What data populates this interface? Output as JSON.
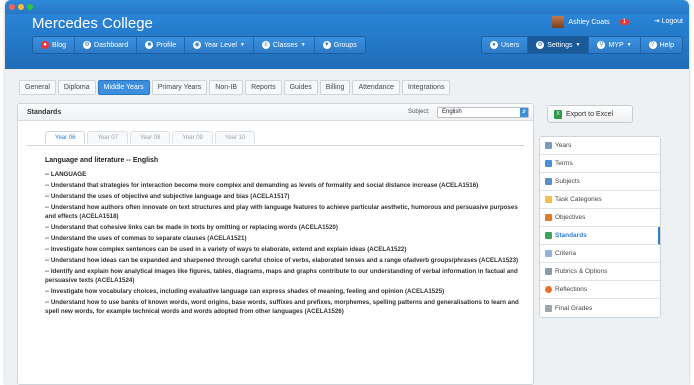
{
  "window": {
    "traffic_lights": [
      "#ff5f57",
      "#febc2e",
      "#28c840"
    ]
  },
  "brand": {
    "title": "Mercedes College"
  },
  "user": {
    "name": "Ashley Coats",
    "notification_count": "1",
    "logout": "Logout"
  },
  "nav_left": [
    {
      "label": "Blog",
      "icon": "blog-icon",
      "badge": ""
    },
    {
      "label": "Dashboard",
      "icon": "dashboard-icon"
    },
    {
      "label": "Profile",
      "icon": "profile-icon"
    },
    {
      "label": "Year Level",
      "icon": "globe-icon",
      "dropdown": true
    },
    {
      "label": "Classes",
      "icon": "list-icon",
      "dropdown": true
    },
    {
      "label": "Groups",
      "icon": "groups-icon"
    }
  ],
  "nav_right": [
    {
      "label": "Users",
      "icon": "users-icon"
    },
    {
      "label": "Settings",
      "icon": "gear-icon",
      "dropdown": true
    },
    {
      "label": "MYP",
      "icon": "search-icon",
      "dropdown": true
    },
    {
      "label": "Help",
      "icon": "help-icon"
    }
  ],
  "tabs": [
    "General",
    "Diploma",
    "Middle Years",
    "Primary Years",
    "Non-IB",
    "Reports",
    "Guides",
    "Billing",
    "Attendance",
    "Integrations"
  ],
  "active_tab": "Middle Years",
  "panel": {
    "title": "Standards",
    "subject_label": "Subject:",
    "subject_value": "English"
  },
  "year_tabs": [
    "Year 06",
    "Year 07",
    "Year 08",
    "Year 09",
    "Year 10"
  ],
  "active_year": "Year 06",
  "content": {
    "heading": "Language and literature -- English",
    "section": "-- LANGUAGE",
    "items": [
      "-- Understand that strategies for interaction become more complex and demanding as levels of formality and social distance increase (ACELA1516)",
      "-- Understand the uses of objective and subjective language and bias (ACELA1517)",
      "-- Understand how authors often innovate on text structures and play with language features to achieve particular aesthetic, humorous and persuasive purposes and effects (ACELA1518)",
      "-- Understand that cohesive links can be made in texts by omitting or replacing words (ACELA1520)",
      "-- Understand the uses of commas to separate clauses (ACELA1521)",
      "-- Investigate how complex sentences can be used in a variety of ways to elaborate, extend and explain ideas (ACELA1522)",
      "-- Understand how ideas can be expanded and sharpened through careful choice of verbs, elaborated tenses and a range ofadverb groups/phrases (ACELA1523)",
      "-- Identify and explain how analytical images like figures, tables, diagrams, maps and graphs contribute to our understanding of verbal information in factual and persuasive texts (ACELA1524)",
      "-- Investigate how vocabulary choices, including evaluative language can express shades of meaning, feeling and opinion (ACELA1525)",
      "-- Understand how to use banks of known words, word origins, base words, suffixes and prefixes, morphemes, spelling patterns and generalisations to learn and spell new words, for example technical words and words adopted from other languages (ACELA1526)"
    ]
  },
  "export": {
    "label": "Export to Excel"
  },
  "side_menu": [
    {
      "label": "Years",
      "icon": "years-icon",
      "color": "#7a9cc2"
    },
    {
      "label": "Terms",
      "icon": "terms-icon",
      "color": "#4a90d9"
    },
    {
      "label": "Subjects",
      "icon": "subjects-icon",
      "color": "#5a8fc8"
    },
    {
      "label": "Task Categories",
      "icon": "folder-icon",
      "color": "#f0c24a"
    },
    {
      "label": "Objectives",
      "icon": "objectives-icon",
      "color": "#e67a22"
    },
    {
      "label": "Standards",
      "icon": "checkbox-icon",
      "color": "#3aa55a"
    },
    {
      "label": "Criteria",
      "icon": "criteria-icon",
      "color": "#8fb3d9"
    },
    {
      "label": "Rubrics & Options",
      "icon": "rubrics-icon",
      "color": "#8a9aaa"
    },
    {
      "label": "Reflections",
      "icon": "reflections-icon",
      "color": "#e8702a"
    },
    {
      "label": "Final Grades",
      "icon": "grades-icon",
      "color": "#9aa5b0"
    }
  ],
  "active_side": "Standards"
}
